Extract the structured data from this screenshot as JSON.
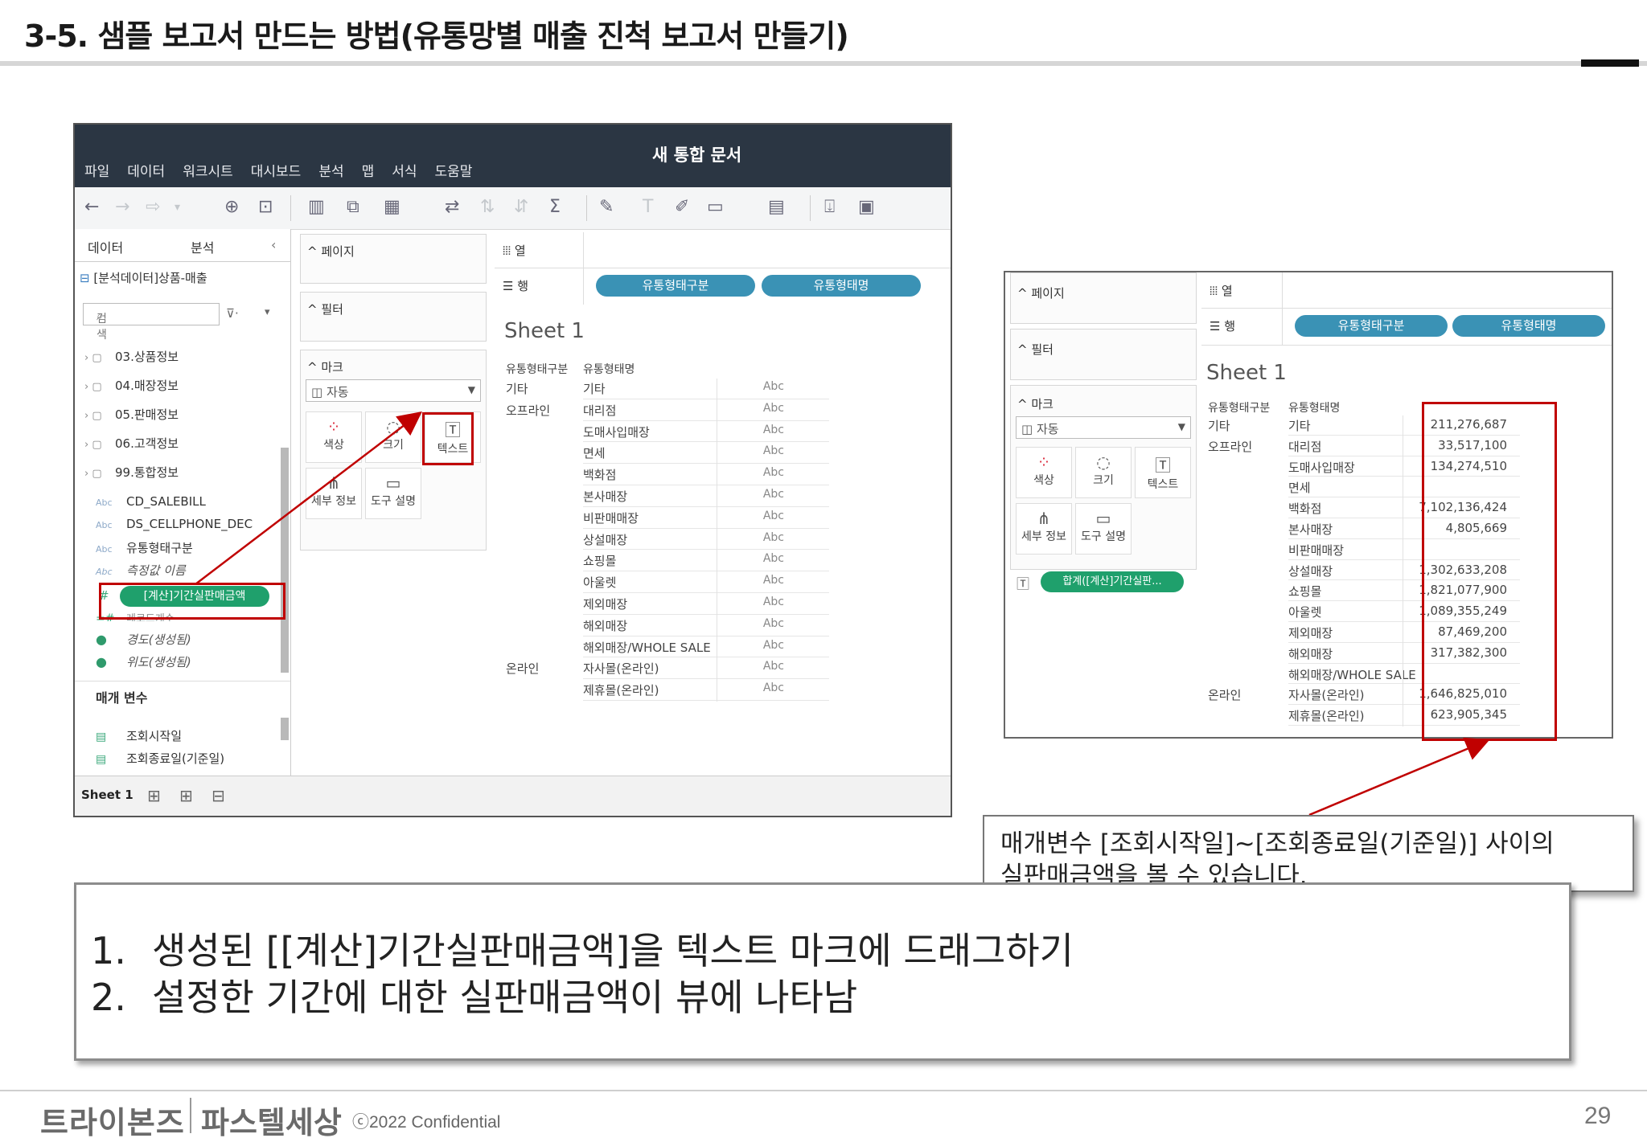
{
  "slide": {
    "title": "3-5. 샘플 보고서 만드는 방법(유통망별 매출 진척 보고서 만들기)",
    "page_number": "29"
  },
  "tableau": {
    "menu": [
      "파일",
      "데이터",
      "워크시트",
      "대시보드",
      "분석",
      "맵",
      "서식",
      "도움말"
    ],
    "doc_title": "새 통합 문서",
    "data_pane": {
      "tab_data": "데이터",
      "tab_analysis": "분석",
      "source": "[분석데이터]상품-매출",
      "search_placeholder": "검색",
      "folders": [
        "03.상품정보",
        "04.매장정보",
        "05.판매정보",
        "06.고객정보",
        "99.통합정보"
      ],
      "fields": [
        "CD_SALEBILL",
        "DS_CELLPHONE_DEC",
        "유통형태구분",
        "측정값 이름"
      ],
      "calc_field": "[계산]기간실판매금액",
      "hidden_field": "레코드개수",
      "geo_fields": [
        "경도(생성됨)",
        "위도(생성됨)"
      ],
      "params_header": "매개 변수",
      "params": [
        "조회시작일",
        "조회종료일(기준일)"
      ]
    },
    "cards": {
      "pages": "페이지",
      "filters": "필터",
      "marks": "마크",
      "marks_type": "자동",
      "mark_buttons": [
        "색상",
        "크기",
        "텍스트",
        "세부 정보",
        "도구 설명"
      ],
      "sum_pill": "합계([계산]기간실판..."
    },
    "shelves": {
      "columns": "열",
      "rows": "행",
      "row_pills": [
        "유통형태구분",
        "유통형태명"
      ]
    },
    "sheet": {
      "title": "Sheet 1",
      "col_headers": [
        "유통형태구분",
        "유통형태명"
      ],
      "rows": [
        {
          "g": "기타",
          "n": "기타",
          "v": "211,276,687"
        },
        {
          "g": "오프라인",
          "n": "대리점",
          "v": "33,517,100"
        },
        {
          "g": "",
          "n": "도매사입매장",
          "v": "134,274,510"
        },
        {
          "g": "",
          "n": "면세",
          "v": ""
        },
        {
          "g": "",
          "n": "백화점",
          "v": "7,102,136,424"
        },
        {
          "g": "",
          "n": "본사매장",
          "v": "4,805,669"
        },
        {
          "g": "",
          "n": "비판매매장",
          "v": ""
        },
        {
          "g": "",
          "n": "상설매장",
          "v": "1,302,633,208"
        },
        {
          "g": "",
          "n": "쇼핑몰",
          "v": "1,821,077,900"
        },
        {
          "g": "",
          "n": "아울렛",
          "v": "1,089,355,249"
        },
        {
          "g": "",
          "n": "제외매장",
          "v": "87,469,200"
        },
        {
          "g": "",
          "n": "해외매장",
          "v": "317,382,300"
        },
        {
          "g": "",
          "n": "해외매장/WHOLE SALE",
          "v": ""
        },
        {
          "g": "온라인",
          "n": "자사몰(온라인)",
          "v": "1,646,825,010"
        },
        {
          "g": "",
          "n": "제휴몰(온라인)",
          "v": "623,905,345"
        }
      ],
      "abc": "Abc"
    },
    "sheet_tab": "Sheet 1"
  },
  "callout": {
    "line1": "매개변수 [조회시작일]~[조회종료일(기준일)] 사이의",
    "line2": "실판매금액을 볼 수 있습니다."
  },
  "steps": [
    {
      "num": "1.",
      "text": "생성된 [[계산]기간실판매금액]을 텍스트 마크에 드래그하기"
    },
    {
      "num": "2.",
      "text": "설정한 기간에 대한 실판매금액이 뷰에 나타남"
    }
  ],
  "footer": {
    "logo1": "트라이본즈",
    "logo2": "파스텔세상",
    "confidential": "ⓒ2022 Confidential"
  }
}
